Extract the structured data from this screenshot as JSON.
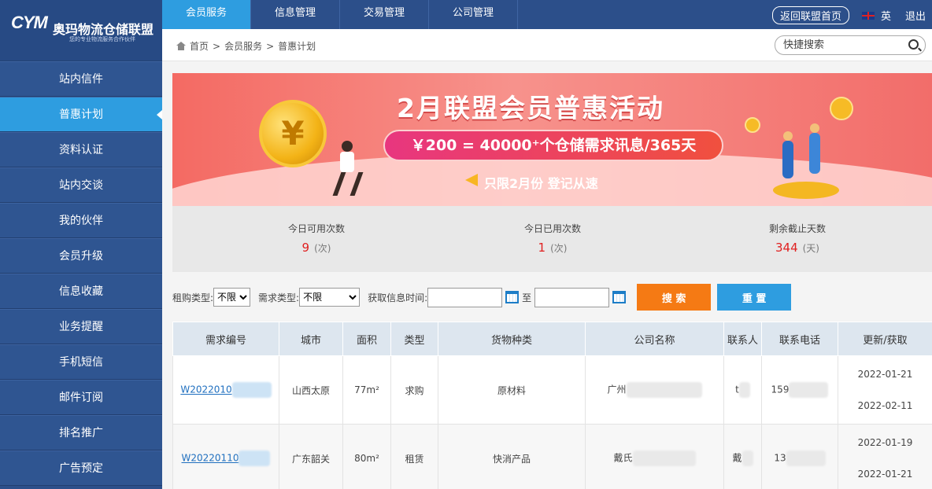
{
  "logo": {
    "mark": "CYM",
    "name": "奥玛物流仓储联盟",
    "sub": "您的专业物流服务合作伙伴"
  },
  "sidebar": {
    "items": [
      {
        "label": "站内信件",
        "active": false
      },
      {
        "label": "普惠计划",
        "active": true
      },
      {
        "label": "资料认证",
        "active": false
      },
      {
        "label": "站内交谈",
        "active": false
      },
      {
        "label": "我的伙伴",
        "active": false
      },
      {
        "label": "会员升级",
        "active": false
      },
      {
        "label": "信息收藏",
        "active": false
      },
      {
        "label": "业务提醒",
        "active": false
      },
      {
        "label": "手机短信",
        "active": false
      },
      {
        "label": "邮件订阅",
        "active": false
      },
      {
        "label": "排名推广",
        "active": false
      },
      {
        "label": "广告预定",
        "active": false
      }
    ]
  },
  "topnav": {
    "tabs": [
      {
        "label": "会员服务",
        "active": true
      },
      {
        "label": "信息管理",
        "active": false
      },
      {
        "label": "交易管理",
        "active": false
      },
      {
        "label": "公司管理",
        "active": false
      }
    ],
    "home_button": "返回联盟首页",
    "lang": "英",
    "logout": "退出"
  },
  "breadcrumb": {
    "home": "首页",
    "level1": "会员服务",
    "level2": "普惠计划",
    "sep": ">"
  },
  "search": {
    "placeholder": "快捷搜索"
  },
  "banner": {
    "title": "2月联盟会员普惠活动",
    "promo": "￥200 = 40000⁺个仓储需求讯息/365天",
    "sub": "只限2月份 登记从速",
    "coin_symbol": "¥"
  },
  "stats": [
    {
      "label": "今日可用次数",
      "value": "9",
      "unit": "(次)"
    },
    {
      "label": "今日已用次数",
      "value": "1",
      "unit": "(次)"
    },
    {
      "label": "剩余截止天数",
      "value": "344",
      "unit": "(天)"
    }
  ],
  "filters": {
    "rent_type_label": "租购类型:",
    "rent_type_value": "不限",
    "need_type_label": "需求类型:",
    "need_type_value": "不限",
    "time_label": "获取信息时间:",
    "to_label": "至",
    "search_button": "搜 索",
    "reset_button": "重 置"
  },
  "table": {
    "headers": [
      "需求编号",
      "城市",
      "面积",
      "类型",
      "货物种类",
      "公司名称",
      "联系人",
      "联系电话",
      "更新/获取"
    ],
    "rows": [
      {
        "id": "W2022010",
        "city": "山西太原",
        "area": "77m²",
        "type": "求购",
        "goods": "原材料",
        "company": "广州",
        "contact": "t",
        "phone": "159",
        "updated": "2022-01-21",
        "fetched": "2022-02-11"
      },
      {
        "id": "W20220110",
        "city": "广东韶关",
        "area": "80m²",
        "type": "租赁",
        "goods": "快消产品",
        "company": "戴氏",
        "contact": "戴",
        "phone": "13",
        "updated": "2022-01-19",
        "fetched": "2022-01-21"
      }
    ]
  },
  "colors": {
    "nav_bg": "#2c4f8a",
    "accent": "#2e9de0",
    "search_btn": "#f57a14",
    "stat_red": "#e02020"
  }
}
